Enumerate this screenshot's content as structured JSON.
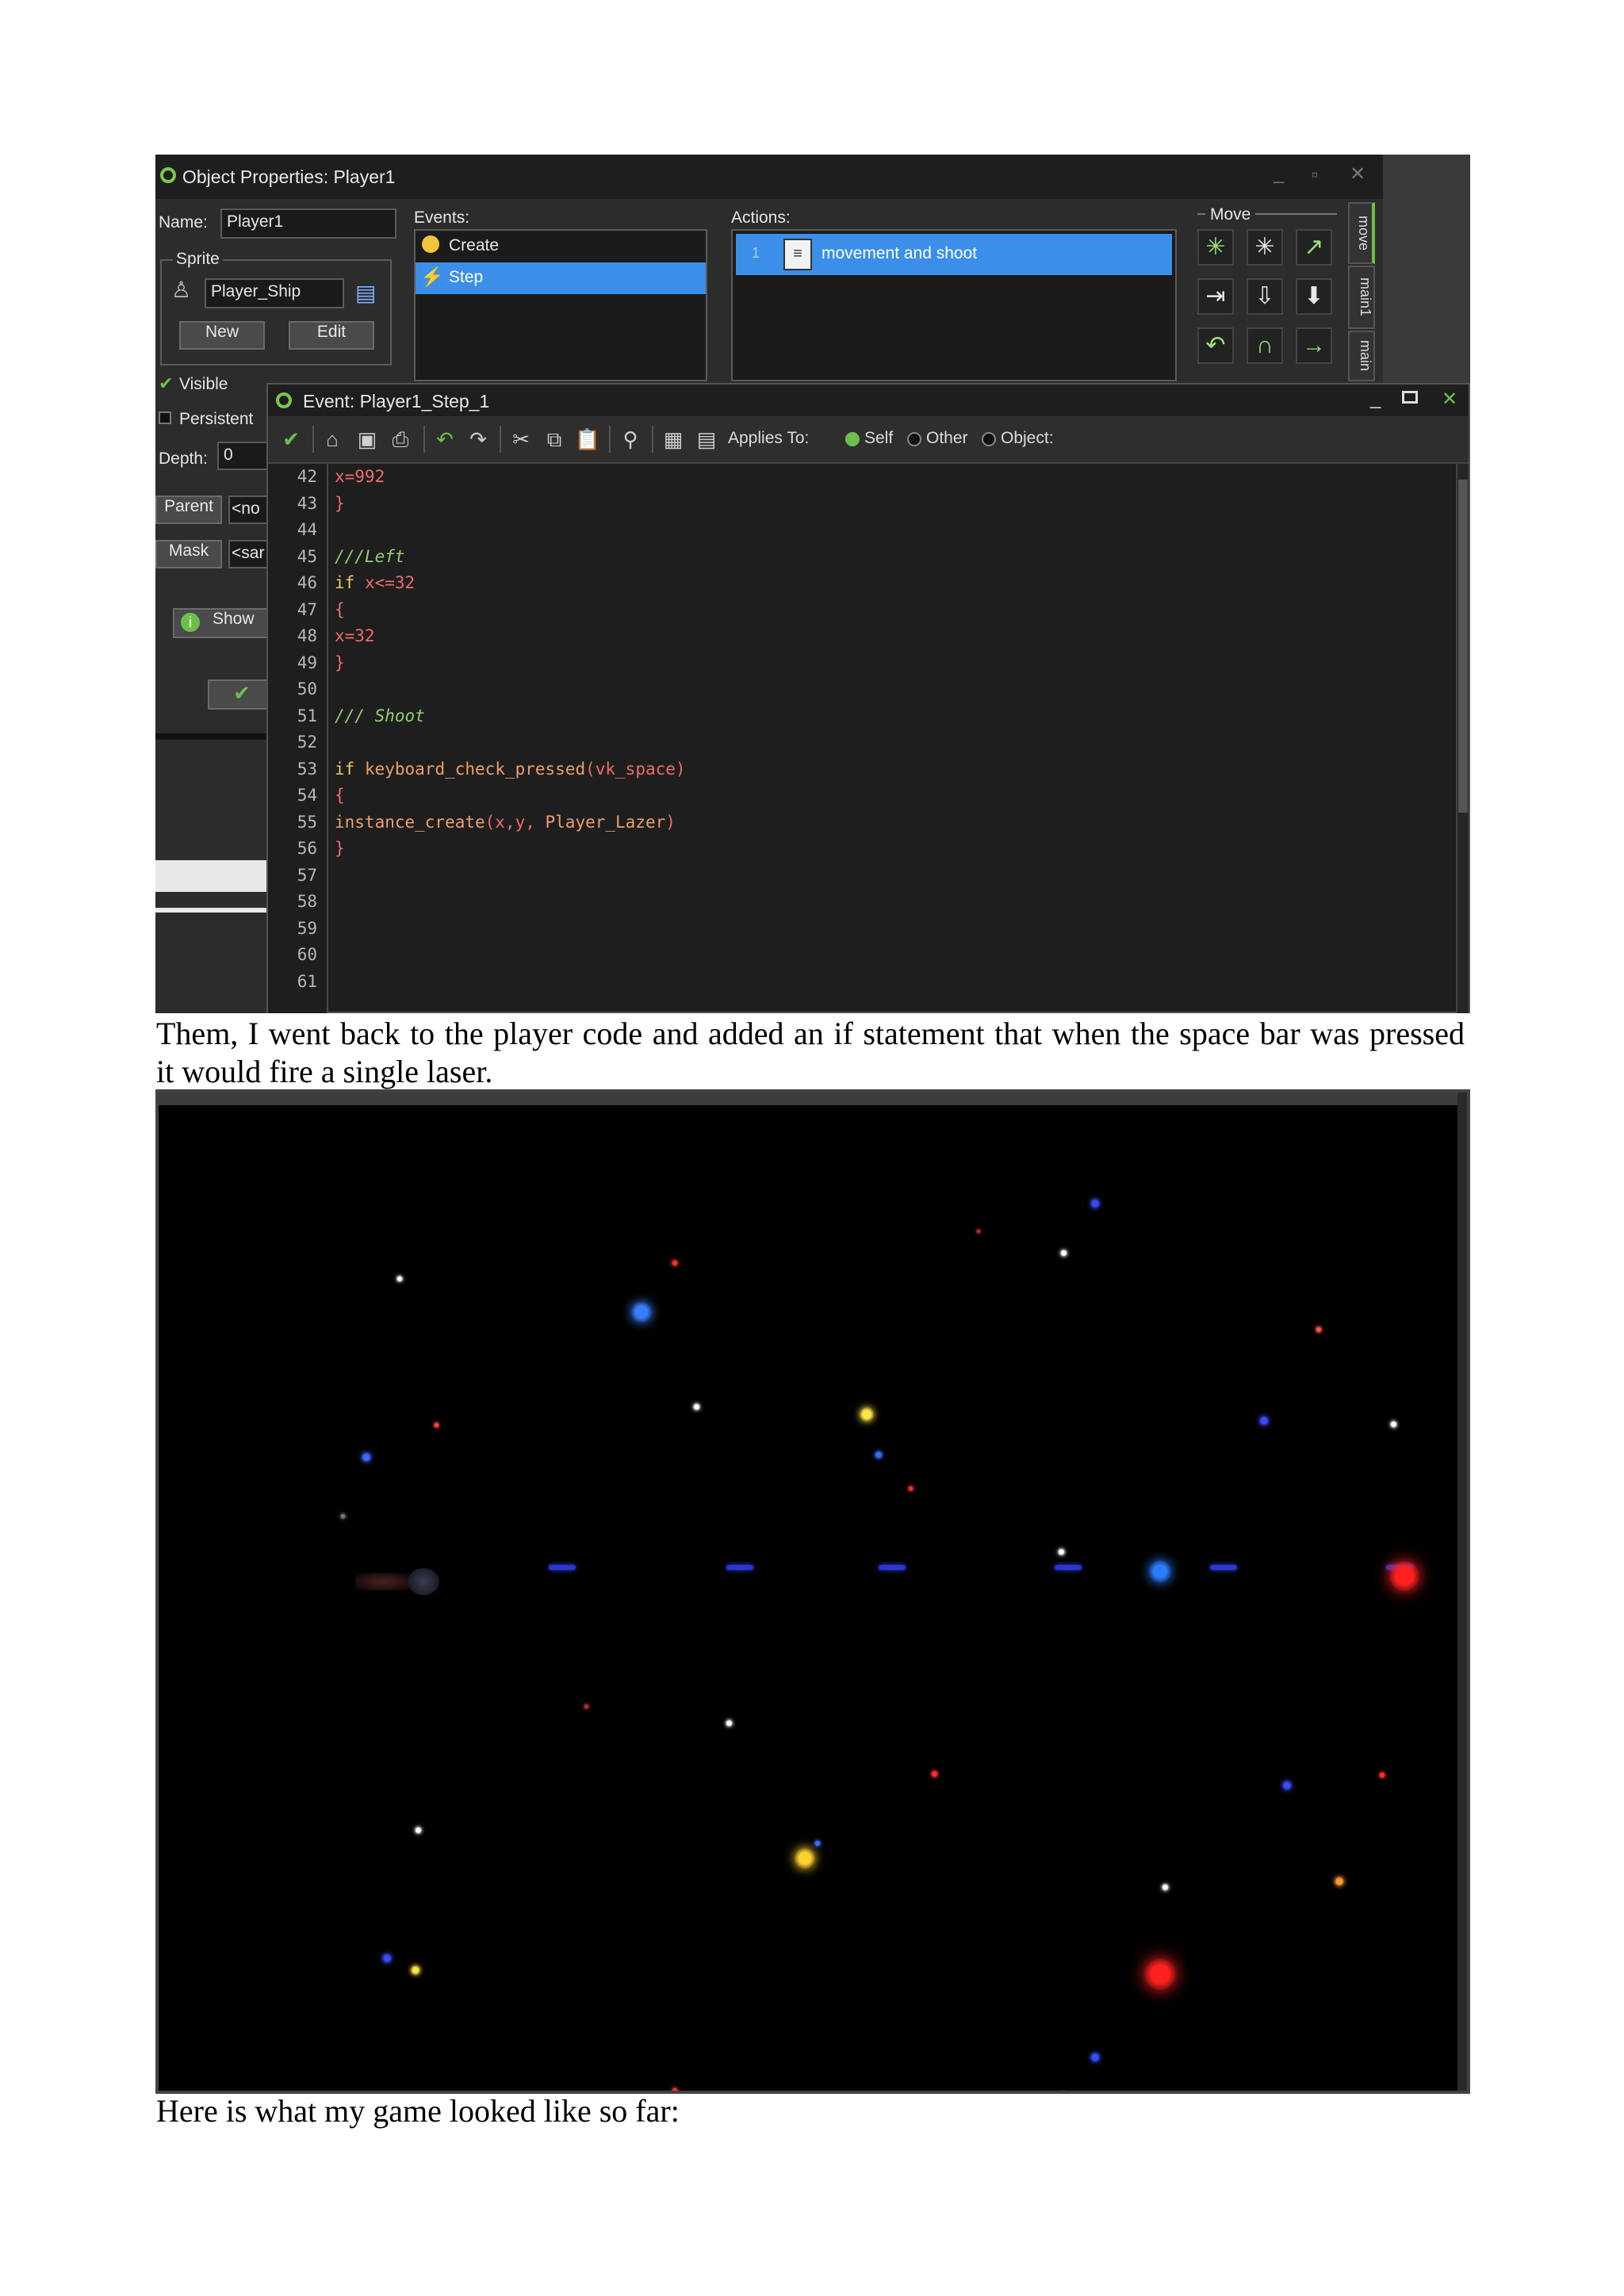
{
  "object_window": {
    "title": "Object Properties: Player1",
    "name_label": "Name:",
    "name_value": "Player1",
    "sprite_group_label": "Sprite",
    "sprite_value": "Player_Ship",
    "new_button": "New",
    "edit_button": "Edit",
    "visible_label": "Visible",
    "persistent_label": "Persistent",
    "depth_label": "Depth:",
    "depth_value": "0",
    "parent_button": "Parent",
    "parent_value": "<no",
    "mask_button": "Mask",
    "mask_value": "<sar",
    "show_button": "Show",
    "events_label": "Events:",
    "events": [
      "Create",
      "Step"
    ],
    "selected_event": "Step",
    "actions_label": "Actions:",
    "action_index": "1",
    "action_text": "movement and shoot",
    "move_group_label": "Move",
    "side_tabs": [
      "move",
      "main1",
      "main"
    ]
  },
  "event_window": {
    "title": "Event: Player1_Step_1",
    "applies_to_label": "Applies To:",
    "options": [
      "Self",
      "Other",
      "Object:"
    ],
    "selected_option": "Self",
    "line_numbers": [
      "42",
      "43",
      "44",
      "45",
      "46",
      "47",
      "48",
      "49",
      "50",
      "51",
      "52",
      "53",
      "54",
      "55",
      "56",
      "57",
      "58",
      "59",
      "60",
      "61"
    ],
    "code": {
      "l42": "x=992",
      "l43": "}",
      "l45": "///Left",
      "l46_kw": "if",
      "l46_rest": "x<=32",
      "l47": "{",
      "l48": "x=32",
      "l49": "}",
      "l51": "/// Shoot",
      "l53_kw": "if",
      "l53_fn": "keyboard_check_pressed",
      "l53_arg": "(vk_space)",
      "l54": "{",
      "l55_fn": "instance_create",
      "l55_a": "(x,y, ",
      "l55_b": "Player_Lazer",
      "l55_c": ")",
      "l56": "}"
    }
  },
  "caption_1": {
    "line1": "Them, I went back to the player code and added an if statement  that when the space bar was pressed",
    "line2": "it would  fire  a single  laser."
  },
  "caption_2": "Here is what my game looked like so far:",
  "colors": {
    "editor_bg": "#1e1e1e",
    "selection_blue": "#3b8fe8",
    "gm_green": "#6cc04a",
    "laser_blue": "#2c36d8"
  }
}
